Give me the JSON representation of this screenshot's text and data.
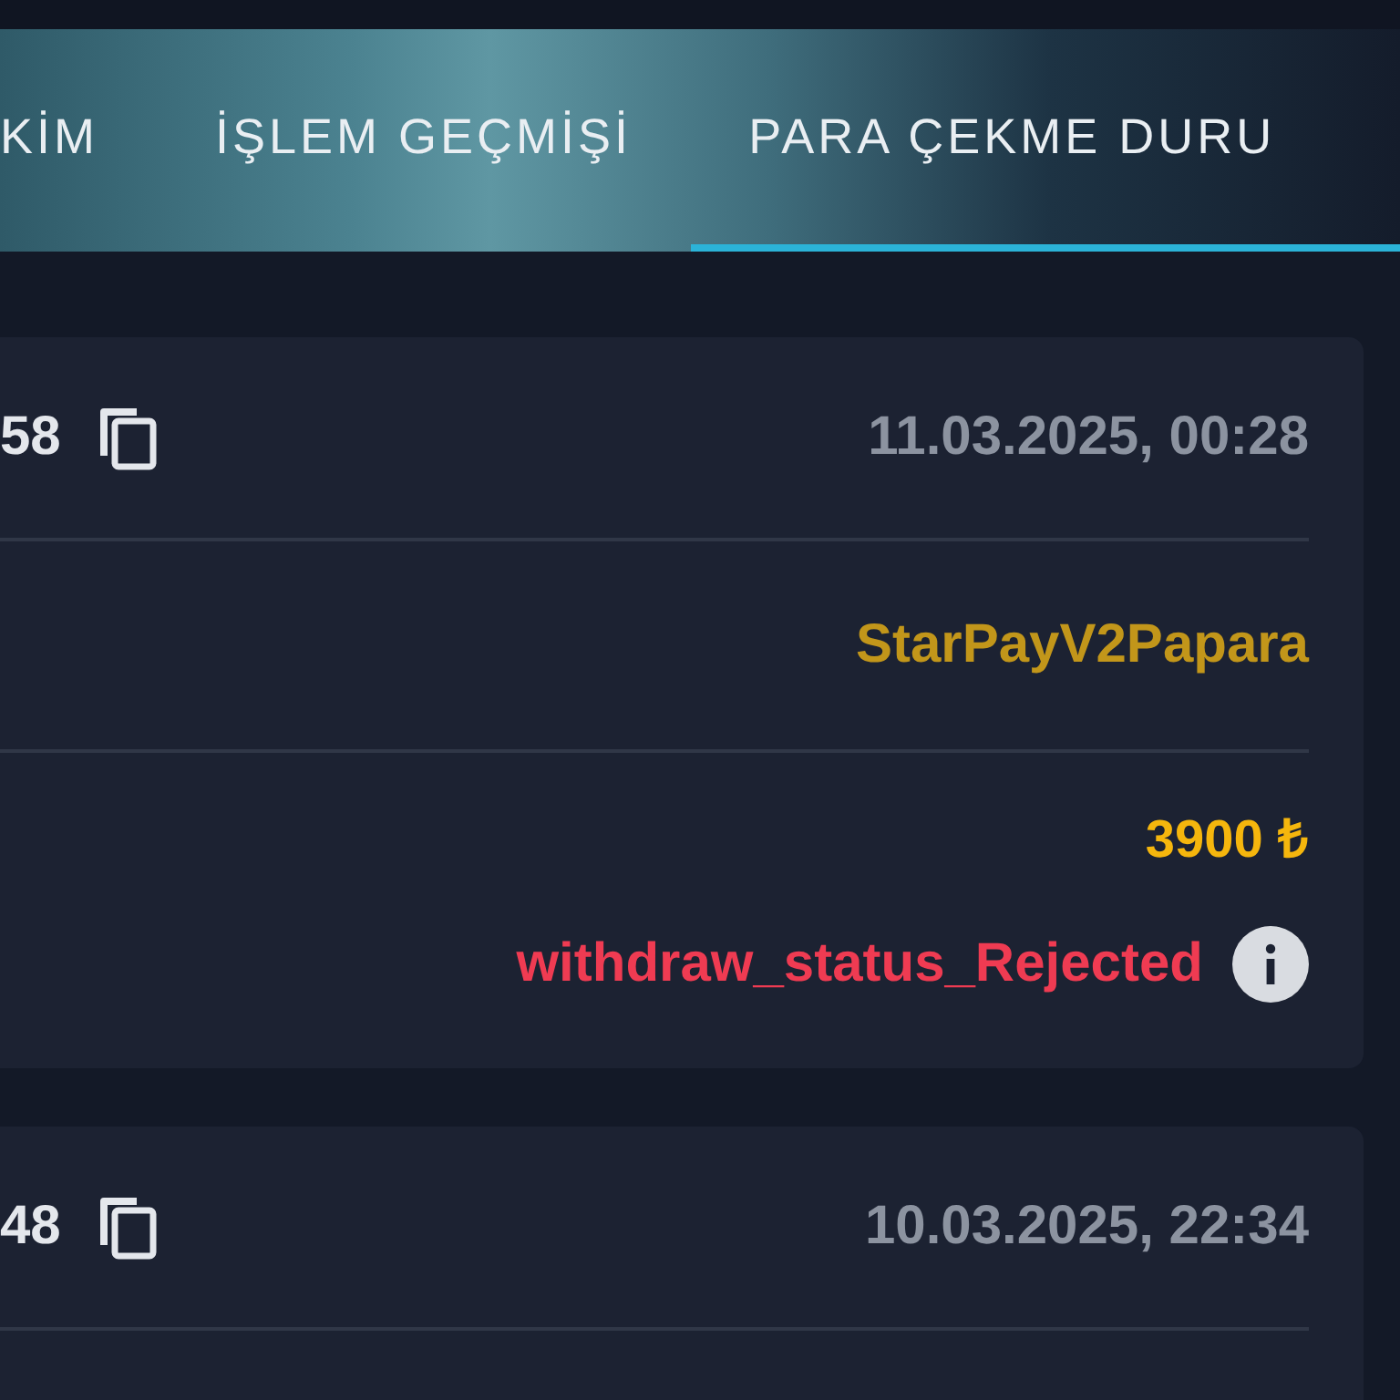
{
  "tabs": [
    {
      "label": "KİM",
      "selected": false
    },
    {
      "label": "İŞLEM GEÇMİŞİ",
      "selected": false
    },
    {
      "label": "PARA ÇEKME DURU",
      "selected": true
    }
  ],
  "withdrawals": [
    {
      "id": "58",
      "date": "11.03.2025, 00:28",
      "method": "StarPayV2Papara",
      "amount": "3900 ₺",
      "status": {
        "text": "withdraw_status_Rejected",
        "kind": "rejected"
      }
    },
    {
      "id": "48",
      "date": "10.03.2025, 22:34"
    }
  ]
}
